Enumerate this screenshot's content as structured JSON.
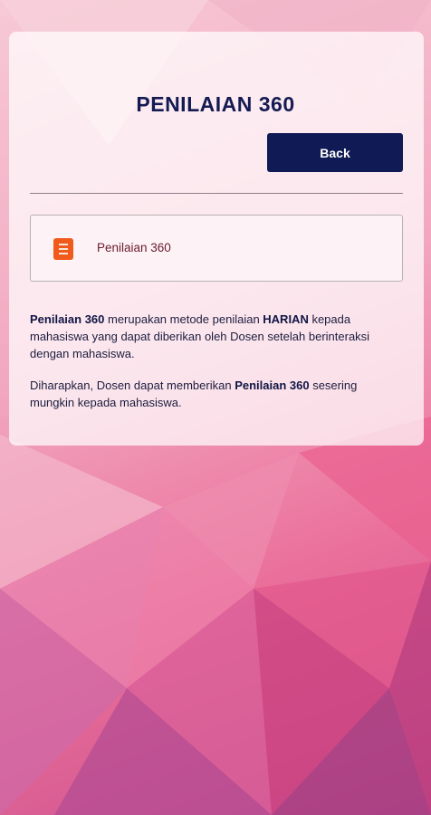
{
  "header": {
    "title": "PENILAIAN 360",
    "back_label": "Back"
  },
  "menu": {
    "items": [
      {
        "label": "Penilaian 360",
        "icon": "document-icon"
      }
    ]
  },
  "description": {
    "p1_bold1": "Penilaian 360",
    "p1_text1": " merupakan metode penilaian ",
    "p1_bold2": "HARIAN",
    "p1_text2": " kepada mahasiswa yang dapat diberikan oleh Dosen setelah berinteraksi dengan mahasiswa.",
    "p2_text1": "Diharapkan, Dosen dapat memberikan ",
    "p2_bold1": "Penilaian 360",
    "p2_text2": " sesering mungkin kepada mahasiswa."
  },
  "colors": {
    "accent": "#101a55",
    "icon": "#f05a1a"
  }
}
